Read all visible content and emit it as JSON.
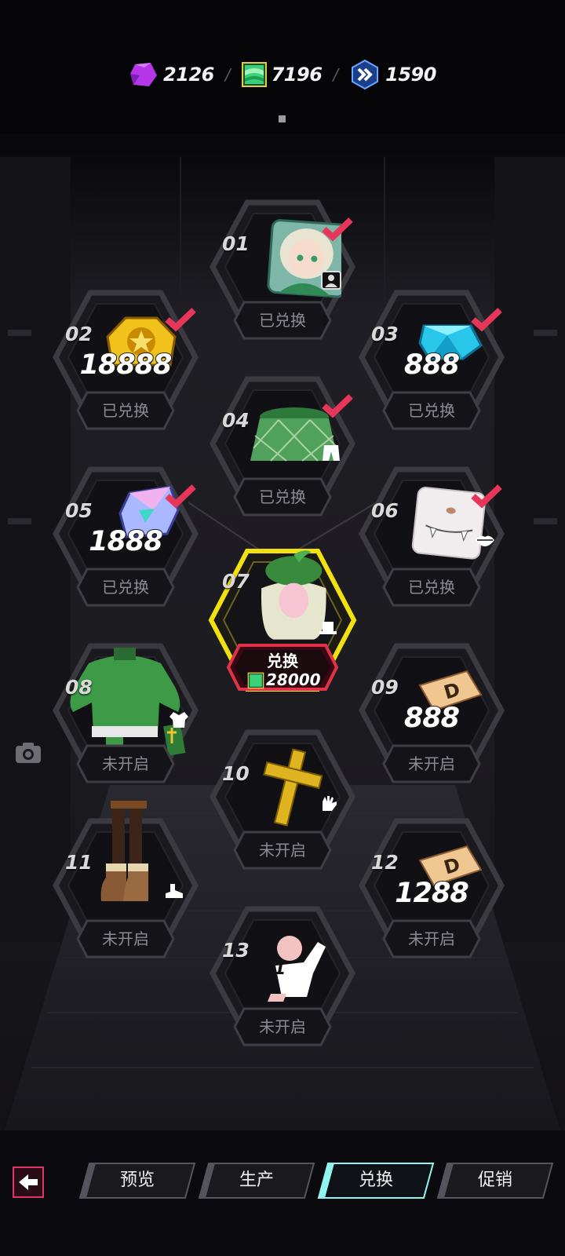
{
  "currencies": [
    {
      "icon": "purple-crystal-icon",
      "value": "2126",
      "color": "#b536e8"
    },
    {
      "icon": "green-ticket-icon",
      "value": "7196",
      "color": "#3bd07a"
    },
    {
      "icon": "blue-chevron-badge-icon",
      "value": "1590",
      "color": "#2f7fe0"
    }
  ],
  "separator": "/",
  "nodes": [
    {
      "num": "01",
      "status": "已兑换",
      "reward": "character-avatar",
      "amount": "",
      "checked": true,
      "type_icon": "character-icon"
    },
    {
      "num": "02",
      "status": "已兑换",
      "reward": "gold-coin-badge",
      "amount": "18888",
      "checked": true,
      "type_icon": ""
    },
    {
      "num": "03",
      "status": "已兑换",
      "reward": "blue-gem",
      "amount": "888",
      "checked": true,
      "type_icon": ""
    },
    {
      "num": "04",
      "status": "已兑换",
      "reward": "green-plaid-skirt",
      "amount": "",
      "checked": true,
      "type_icon": "bottom-icon"
    },
    {
      "num": "05",
      "status": "已兑换",
      "reward": "crystal-ticket",
      "amount": "1888",
      "checked": true,
      "type_icon": ""
    },
    {
      "num": "06",
      "status": "已兑换",
      "reward": "face-sticker",
      "amount": "",
      "checked": true,
      "type_icon": "lips-icon"
    },
    {
      "num": "07",
      "status": "兑换",
      "reward": "green-beret-hair",
      "amount": "",
      "checked": false,
      "type_icon": "hat-icon",
      "cost": "28000"
    },
    {
      "num": "08",
      "status": "未开启",
      "reward": "green-jacket-outfit",
      "amount": "",
      "checked": false,
      "type_icon": "top-icon"
    },
    {
      "num": "09",
      "status": "未开启",
      "reward": "d-ticket",
      "amount": "888",
      "checked": false,
      "type_icon": ""
    },
    {
      "num": "10",
      "status": "未开启",
      "reward": "gold-cross",
      "amount": "",
      "checked": false,
      "type_icon": "glove-icon"
    },
    {
      "num": "11",
      "status": "未开启",
      "reward": "brown-boots",
      "amount": "",
      "checked": false,
      "type_icon": "shoe-icon"
    },
    {
      "num": "12",
      "status": "未开启",
      "reward": "d-ticket",
      "amount": "1288",
      "checked": false,
      "type_icon": ""
    },
    {
      "num": "13",
      "status": "未开启",
      "reward": "pose-action",
      "amount": "",
      "checked": false,
      "type_icon": ""
    }
  ],
  "pose_number": "1",
  "tabs": [
    {
      "label": "预览",
      "active": false
    },
    {
      "label": "生产",
      "active": false
    },
    {
      "label": "兑换",
      "active": true
    },
    {
      "label": "促销",
      "active": false
    }
  ],
  "colors": {
    "accent": "#e0336a",
    "check": "#e8365a",
    "selected": "#f2e10e",
    "active_tab": "#8ff5ee"
  }
}
